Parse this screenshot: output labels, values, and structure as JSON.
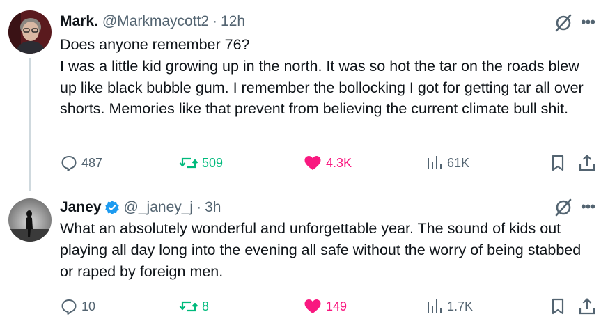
{
  "tweets": [
    {
      "display_name": "Mark.",
      "handle": "@Markmaycott2",
      "separator": "·",
      "time": "12h",
      "verified": false,
      "text": "Does anyone remember 76?\nI was a little kid growing up in the north. It was so hot the tar on the roads blew up like black bubble gum. I remember the bollocking I got for getting tar all over shorts. Memories like that prevent from believing the current climate bull shit.",
      "stats": {
        "replies": "487",
        "reposts": "509",
        "likes": "4.3K",
        "views": "61K"
      },
      "liked": true
    },
    {
      "display_name": "Janey",
      "handle": "@_janey_j",
      "separator": "·",
      "time": "3h",
      "verified": true,
      "text": "What an absolutely wonderful and unforgettable year. The sound of kids out playing all day long into the evening all safe without the worry of being stabbed or raped by foreign men.",
      "stats": {
        "replies": "10",
        "reposts": "8",
        "likes": "149",
        "views": "1.7K"
      },
      "liked": true
    }
  ],
  "icons": {
    "reply": "reply-icon",
    "repost": "repost-icon",
    "like": "heart-icon",
    "views": "views-icon",
    "bookmark": "bookmark-icon",
    "share": "share-icon",
    "grok": "grok-icon",
    "more": "more-icon"
  },
  "colors": {
    "text": "#0f1419",
    "secondary": "#536471",
    "repost": "#00ba7c",
    "like": "#f91880",
    "verified": "#1d9bf0",
    "thread_line": "#cfd9de"
  }
}
